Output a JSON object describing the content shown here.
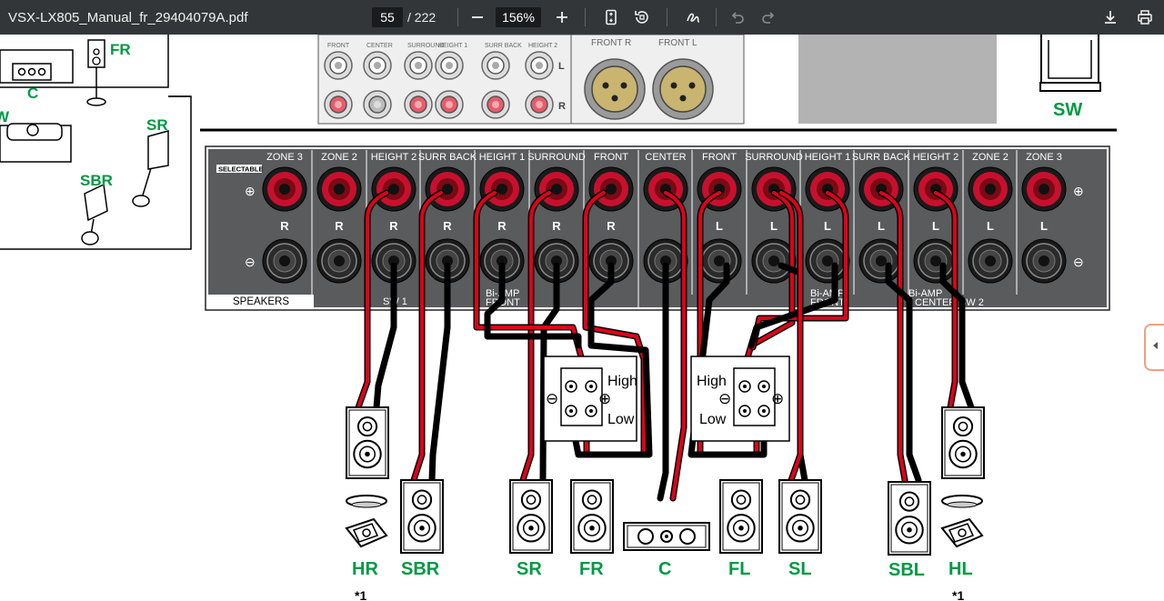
{
  "toolbar": {
    "filename": "VSX-LX805_Manual_fr_29404079A.pdf",
    "current_page": "55",
    "total_pages": "/ 222",
    "zoom": "156%",
    "icons": [
      "zoom-out-icon",
      "zoom-in-icon",
      "fit-page-icon",
      "rotate-icon",
      "annotate-icon",
      "undo-icon",
      "redo-icon",
      "download-icon",
      "print-icon"
    ]
  },
  "diagram": {
    "room_labels": {
      "fr": "FR",
      "c": "C",
      "w": "W",
      "sr": "SR",
      "sbr": "SBR",
      "sw": "SW"
    },
    "top_panel": {
      "rca_labels": [
        "FRONT",
        "CENTER",
        "SURROUND",
        "HEIGHT 1",
        "SURR BACK",
        "HEIGHT 2"
      ],
      "xlr_labels": [
        "FRONT R",
        "FRONT L"
      ],
      "side_l": "L",
      "side_r": "R"
    },
    "terminal_headers": [
      "ZONE 3",
      "ZONE 2",
      "HEIGHT 2",
      "SURR BACK",
      "HEIGHT 1",
      "SURROUND",
      "FRONT",
      "CENTER",
      "FRONT",
      "SURROUND",
      "HEIGHT 1",
      "SURR BACK",
      "HEIGHT 2",
      "ZONE 2",
      "ZONE 3"
    ],
    "terminal_sides": [
      "R",
      "R",
      "R",
      "R",
      "R",
      "R",
      "R",
      "",
      "L",
      "L",
      "L",
      "L",
      "L",
      "L",
      "L"
    ],
    "selectable": "SELECTABLE",
    "speakers_label": "SPEAKERS",
    "sw1_label": "SW 1",
    "biamp_left": [
      "Bi-AMP",
      "FRONT"
    ],
    "biamp_right": [
      "Bi-AMP",
      "FRONT"
    ],
    "biamp_center": [
      "Bi-AMP",
      "CENTER"
    ],
    "sw2_label": "SW 2",
    "plus": "⊕",
    "minus": "⊖",
    "biamp_box_left": {
      "high": "High",
      "low": "Low"
    },
    "biamp_box_right": {
      "high": "High",
      "low": "Low"
    },
    "speaker_labels": [
      "HR",
      "SBR",
      "SR",
      "FR",
      "C",
      "FL",
      "SL",
      "SBL",
      "HL"
    ],
    "footnote_mark": "*1"
  },
  "colors": {
    "toolbar_bg": "#323639",
    "label_green": "#009a44",
    "wire_red": "#e0001b",
    "panel_gray": "#58595b"
  }
}
